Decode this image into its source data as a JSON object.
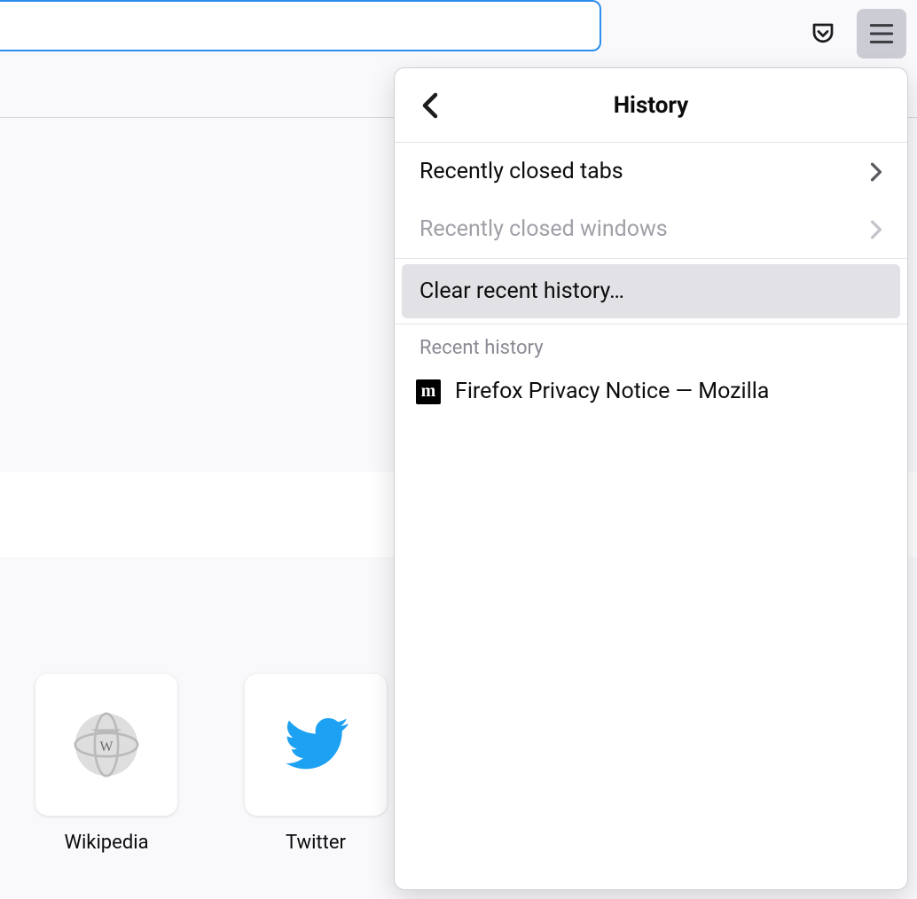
{
  "toolbar": {
    "address_value": "",
    "pocket_icon": "pocket",
    "menu_icon": "hamburger"
  },
  "panel": {
    "title": "History",
    "recently_closed_tabs": "Recently closed tabs",
    "recently_closed_windows": "Recently closed windows",
    "clear_recent": "Clear recent history…",
    "section_label": "Recent history",
    "entries": [
      {
        "favicon_letter": "m",
        "title": "Firefox Privacy Notice — Mozilla"
      }
    ]
  },
  "topsites": [
    {
      "label": "Wikipedia",
      "icon": "wikipedia"
    },
    {
      "label": "Twitter",
      "icon": "twitter"
    }
  ]
}
